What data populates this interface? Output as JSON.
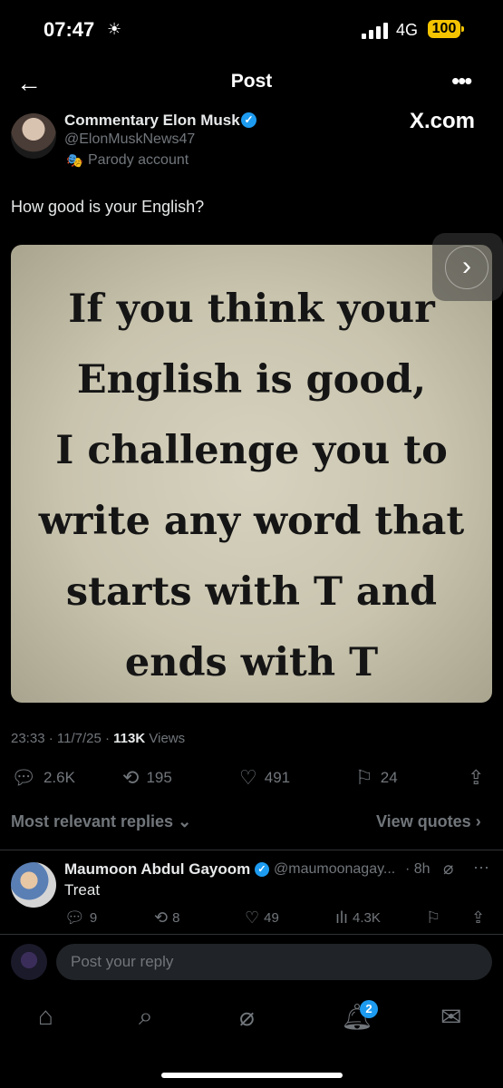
{
  "status_bar": {
    "time": "07:47",
    "network": "4G",
    "battery": "100"
  },
  "header": {
    "title": "Post"
  },
  "post": {
    "author_name": "Commentary Elon Musk",
    "handle": "@ElonMuskNews47",
    "label": "Parody account",
    "source": "X.com",
    "text": "How good is your English?",
    "image_text_lines": [
      "If you think your",
      "English is good,",
      "I challenge you to",
      "write any word that",
      "starts with T and",
      "ends with T"
    ],
    "time": "23:33",
    "date": "11/7/25",
    "views_count": "113K",
    "views_label": "Views",
    "replies": "2.6K",
    "reposts": "195",
    "likes": "491",
    "bookmarks": "24"
  },
  "replies_header": {
    "sort_label": "Most relevant replies",
    "quotes_label": "View quotes"
  },
  "reply": {
    "author_name": "Maumoon Abdul Gayoom",
    "handle": "@maumoonagay...",
    "time": "8h",
    "text": "Treat",
    "replies": "9",
    "reposts": "8",
    "likes": "49",
    "views": "4.3K"
  },
  "composer": {
    "placeholder": "Post your reply"
  },
  "tabbar": {
    "notifications_badge": "2"
  },
  "colors": {
    "accent": "#1d9bf0",
    "background": "#000000",
    "muted": "#71767b",
    "battery": "#f5c400"
  }
}
